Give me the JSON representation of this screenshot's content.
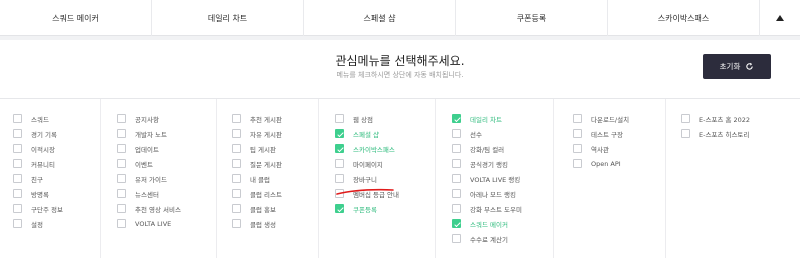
{
  "topnav": {
    "tabs": [
      "스쿼드 메이커",
      "데일리 차트",
      "스페셜 샵",
      "쿠폰등록",
      "스카이박스패스"
    ]
  },
  "panel": {
    "title": "관심메뉴를 선택해주세요.",
    "subtitle": "메뉴를 체크하시면 상단에 자동 배치됩니다.",
    "reset_label": "초기화"
  },
  "colors": {
    "accent": "#3ecf8e",
    "button_dark": "#2c2c3c",
    "underline": "#e01b1b"
  },
  "columns": [
    [
      {
        "label": "스쿼드",
        "checked": false
      },
      {
        "label": "경기 기록",
        "checked": false
      },
      {
        "label": "이적시장",
        "checked": false
      },
      {
        "label": "커뮤니티",
        "checked": false
      },
      {
        "label": "친구",
        "checked": false
      },
      {
        "label": "방명록",
        "checked": false
      },
      {
        "label": "구단주 정보",
        "checked": false
      },
      {
        "label": "설정",
        "checked": false
      }
    ],
    [
      {
        "label": "공지사항",
        "checked": false
      },
      {
        "label": "개발자 노트",
        "checked": false
      },
      {
        "label": "업데이트",
        "checked": false
      },
      {
        "label": "이벤트",
        "checked": false
      },
      {
        "label": "유저 가이드",
        "checked": false
      },
      {
        "label": "뉴스센터",
        "checked": false
      },
      {
        "label": "추천 영상 서비스",
        "checked": false
      },
      {
        "label": "VOLTA LIVE",
        "checked": false
      }
    ],
    [
      {
        "label": "추천 게시판",
        "checked": false
      },
      {
        "label": "자유 게시판",
        "checked": false
      },
      {
        "label": "팁 게시판",
        "checked": false
      },
      {
        "label": "질문 게시판",
        "checked": false
      },
      {
        "label": "내 클럽",
        "checked": false
      },
      {
        "label": "클럽 리스트",
        "checked": false
      },
      {
        "label": "클럽 홍보",
        "checked": false
      },
      {
        "label": "클럽 생성",
        "checked": false
      }
    ],
    [
      {
        "label": "웹 상점",
        "checked": false
      },
      {
        "label": "스페셜 샵",
        "checked": true
      },
      {
        "label": "스카이박스패스",
        "checked": true
      },
      {
        "label": "마이페이지",
        "checked": false
      },
      {
        "label": "장바구니",
        "checked": false
      },
      {
        "label": "멤버십 등급 안내",
        "checked": false
      },
      {
        "label": "쿠폰등록",
        "checked": true
      }
    ],
    [
      {
        "label": "데일리 차트",
        "checked": true
      },
      {
        "label": "선수",
        "checked": false
      },
      {
        "label": "강화/팀 컬러",
        "checked": false
      },
      {
        "label": "공식경기 랭킹",
        "checked": false
      },
      {
        "label": "VOLTA LIVE 랭킹",
        "checked": false
      },
      {
        "label": "아레나 모드 랭킹",
        "checked": false
      },
      {
        "label": "강화 부스트 도우미",
        "checked": false
      },
      {
        "label": "스쿼드 메이커",
        "checked": true
      },
      {
        "label": "수수료 계산기",
        "checked": false
      }
    ],
    [
      {
        "label": "다운로드/설치",
        "checked": false
      },
      {
        "label": "테스트 구장",
        "checked": false
      },
      {
        "label": "역사관",
        "checked": false
      },
      {
        "label": "Open API",
        "checked": false
      }
    ],
    [
      {
        "label": "E-스포츠 홈 2022",
        "checked": false
      },
      {
        "label": "E-스포츠 히스토리",
        "checked": false
      }
    ]
  ]
}
